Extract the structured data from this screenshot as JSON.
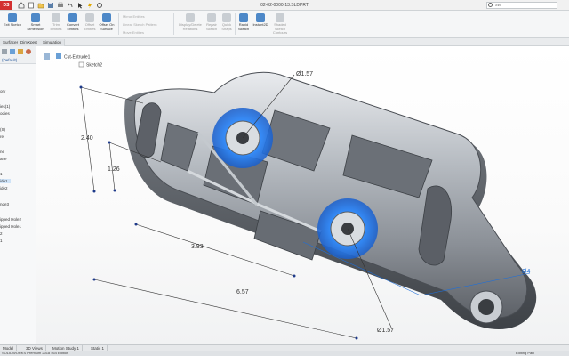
{
  "app": {
    "logo_text": "DS",
    "document_title": "02-02-0000-13.SLDPRT"
  },
  "search": {
    "placeholder": "sw"
  },
  "ribbon": {
    "tools": [
      {
        "label": "Exit Sketch",
        "enabled": true
      },
      {
        "label": "Smart Dimension",
        "enabled": true
      },
      {
        "label": "Trim Entities",
        "enabled": false
      },
      {
        "label": "Convert Entities",
        "enabled": true
      },
      {
        "label": "Offset Entities",
        "enabled": false
      },
      {
        "label": "Offset On Surface",
        "enabled": true
      },
      {
        "label": "Mirror Entities",
        "enabled": false
      },
      {
        "label": "Linear Sketch Pattern",
        "enabled": false
      },
      {
        "label": "Move Entities",
        "enabled": false
      },
      {
        "label": "Display/Delete Relations",
        "enabled": false
      },
      {
        "label": "Repair Sketch",
        "enabled": false
      },
      {
        "label": "Quick Snaps",
        "enabled": false
      },
      {
        "label": "Rapid Sketch",
        "enabled": true
      },
      {
        "label": "Instant2D",
        "enabled": true
      },
      {
        "label": "Shaded Sketch Contours",
        "enabled": false
      }
    ]
  },
  "command_tabs": [
    "Surfaces",
    "DimXpert",
    "Simulation"
  ],
  "breadcrumb": {
    "feature": "Cut-Extrude1",
    "sketch": "Sketch2"
  },
  "feature_tree": {
    "config": "(Default)",
    "items": [
      "ory",
      "ies(1)",
      "odies",
      "(S)",
      "re",
      "ne",
      "ane",
      "1",
      "ide1",
      "ide2",
      "nde3",
      "ipped Hole2",
      "ipped Hole1",
      "2",
      "1"
    ],
    "selected_index": 8
  },
  "dimensions": {
    "d1": "2.40",
    "d2": "1.26",
    "d3": "3.83",
    "d4": "6.57",
    "d5": "Ø1.57",
    "d6": "Ø1.57",
    "d7": "Ø4"
  },
  "bottom_tabs": [
    "Model",
    "3D Views",
    "Motion Study 1",
    "Static 1"
  ],
  "status": {
    "left": "SOLIDWORKS Premium 2018 x64 Edition",
    "right": "Editing Part"
  },
  "colors": {
    "accent": "#1e6fd9",
    "highlight_blue": "#2f8cff",
    "logo": "#d32f2f"
  }
}
